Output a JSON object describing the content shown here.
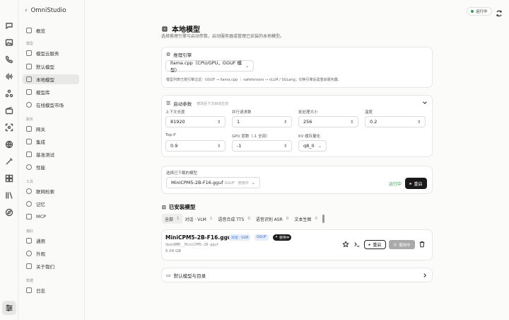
{
  "sidebar": {
    "back_label": "OmniStudio",
    "sections": {
      "models": "模型",
      "services": "服务",
      "tools": "工具",
      "preferences": "偏好",
      "data": "数据"
    },
    "items": {
      "overview": "概览",
      "cloud": "模型云服务",
      "default": "默认模型",
      "local": "本地模型",
      "library": "模型库",
      "market": "在线模型市场",
      "gateway": "网关",
      "integration": "集成",
      "benchmark": "基准测试",
      "performance": "性能",
      "websearch": "联网检索",
      "memory": "记忆",
      "mcp": "MCP",
      "general": "通用",
      "appearance": "外观",
      "about": "关于我们",
      "logs": "日志"
    }
  },
  "top": {
    "status": "运行中"
  },
  "page": {
    "title": "本地模型",
    "subtitle": "选择推理引擎与启动参数，启动服务器或管理已安装的本地模型。"
  },
  "engine": {
    "title": "推理引擎",
    "selected": "llama.cpp（CPU/GPU，GGUF 模型）",
    "note": "模型列表已按引擎过滤：GGUF → llama.cpp ｜ safetensors → vLLM / SGLang；切换引擎后需重启服务器。"
  },
  "params": {
    "title": "启动参数",
    "hint": "修改后下次启动生效",
    "fields": {
      "ctx": {
        "label": "上下文长度",
        "value": "81920"
      },
      "parallel": {
        "label": "并行请求数",
        "value": "1"
      },
      "batch": {
        "label": "批处理大小",
        "value": "256"
      },
      "temp": {
        "label": "温度",
        "value": "0.2"
      },
      "top_p": {
        "label": "Top-P",
        "value": "0.9"
      },
      "gpu_layers": {
        "label": "GPU 层数（-1 全部）",
        "value": "-1"
      },
      "kv_cache": {
        "label": "KV 缓存量化",
        "value": "q8_0"
      }
    }
  },
  "downloaded": {
    "label": "选择已下载的模型",
    "model": "MiniCPM5-2B-F16.gguf",
    "tags": "GGUF · 使用中",
    "status": "运行中",
    "restart": "重启"
  },
  "installed": {
    "title": "已安装模型",
    "tabs": [
      {
        "label": "全部",
        "count": "1"
      },
      {
        "label": "对话 · VLM",
        "count": "1"
      },
      {
        "label": "语音合成 TTS",
        "count": "0"
      },
      {
        "label": "语音识别 ASR",
        "count": "0"
      },
      {
        "label": "文本生图",
        "count": "0"
      }
    ],
    "model": {
      "name": "MiniCPM5-2B-F16.gguf",
      "chip_type": "对话 · VLM",
      "chip_format": "GGUF",
      "chip_active": "使用中",
      "path": "OpenBMB__MiniCPM5-2B-gguf",
      "size": "5.04 GB",
      "restart": "重启",
      "in_use": "使用中"
    }
  },
  "default_models": {
    "label": "默认模型与目录"
  }
}
